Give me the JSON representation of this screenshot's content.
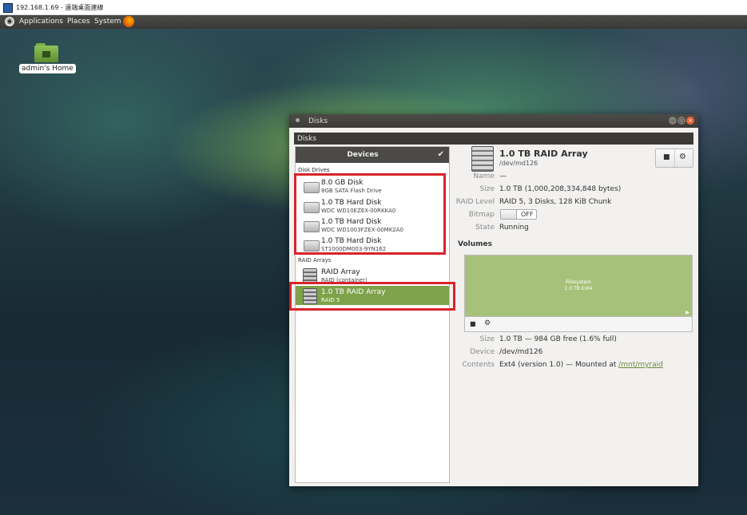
{
  "remote_window": {
    "title": "192.168.1.69 - 遠端桌面連線"
  },
  "top_panel": {
    "menus": [
      "Applications",
      "Places",
      "System"
    ]
  },
  "desktop": {
    "home_label": "admin's Home"
  },
  "window": {
    "title": "Disks",
    "app_menu": "Disks",
    "devices_header": "Devices",
    "sections": {
      "disk_drives": "Disk Drives",
      "raid_arrays": "RAID Arrays"
    },
    "disk_drives": [
      {
        "name": "8.0 GB Disk",
        "sub": "8GB SATA Flash Drive"
      },
      {
        "name": "1.0 TB Hard Disk",
        "sub": "WDC WD10EZEX-00RKKA0"
      },
      {
        "name": "1.0 TB Hard Disk",
        "sub": "WDC WD1003FZEX-00MK2A0"
      },
      {
        "name": "1.0 TB Hard Disk",
        "sub": "ST1000DM003-9YN162"
      }
    ],
    "raid_arrays": [
      {
        "name": "RAID Array",
        "sub": "RAID (container)"
      },
      {
        "name": "1.0 TB RAID Array",
        "sub": "RAID 5"
      }
    ],
    "selected": {
      "title": "1.0 TB RAID Array",
      "path": "/dev/md126",
      "props": {
        "name_label": "Name",
        "name_value": "—",
        "size_label": "Size",
        "size_value": "1.0 TB (1,000,208,334,848 bytes)",
        "raid_label": "RAID Level",
        "raid_value": "RAID 5, 3 Disks, 128 KiB Chunk",
        "bitmap_label": "Bitmap",
        "bitmap_value": "OFF",
        "state_label": "State",
        "state_value": "Running"
      },
      "volumes_title": "Volumes",
      "volume_map": {
        "line1": "Filesystem",
        "line2": "1.0 TB Ext4"
      },
      "volume_props": {
        "size_label": "Size",
        "size_value": "1.0 TB — 984 GB free (1.6% full)",
        "device_label": "Device",
        "device_value": "/dev/md126",
        "contents_label": "Contents",
        "contents_value": "Ext4 (version 1.0) — Mounted at",
        "mount_link": "/mnt/myraid"
      }
    }
  },
  "colors": {
    "selection": "#7ea24a",
    "highlight_box": "#d9232a",
    "volume_fill": "#a6c27a"
  }
}
